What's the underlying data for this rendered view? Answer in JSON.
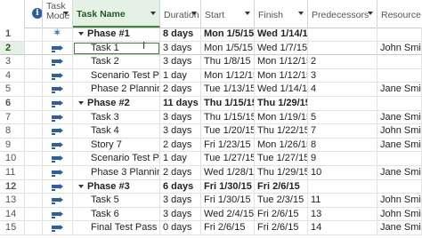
{
  "columns": {
    "mode": "Task Mode",
    "name": "Task Name",
    "duration": "Duration",
    "start": "Start",
    "finish": "Finish",
    "predecessors": "Predecessors",
    "resource": "Resource Na"
  },
  "info_glyph": "i",
  "cursor_glyph": "I",
  "rows": [
    {
      "num": "1",
      "mode": "manual-pin",
      "name": "Phase #1",
      "duration": "8 days",
      "start": "Mon 1/5/15",
      "finish": "Wed 1/14/15",
      "pred": "",
      "res": "",
      "summary": true
    },
    {
      "num": "2",
      "mode": "auto",
      "name": "Task 1",
      "duration": "3 days",
      "start": "Mon 1/5/15",
      "finish": "Wed 1/7/15",
      "pred": "",
      "res": "John Smith",
      "summary": false
    },
    {
      "num": "3",
      "mode": "auto",
      "name": "Task 2",
      "duration": "3 days",
      "start": "Thu 1/8/15",
      "finish": "Mon 1/12/15",
      "pred": "2",
      "res": "",
      "summary": false
    },
    {
      "num": "4",
      "mode": "auto",
      "name": "Scenario Test Pass",
      "duration": "1 day",
      "start": "Mon 1/12/15",
      "finish": "Mon 1/12/15",
      "pred": "3",
      "res": "",
      "summary": false
    },
    {
      "num": "5",
      "mode": "auto",
      "name": "Phase 2 Planning",
      "duration": "2 days",
      "start": "Tue 1/13/15",
      "finish": "Wed 1/14/15",
      "pred": "4",
      "res": "Jane Smith",
      "summary": false
    },
    {
      "num": "6",
      "mode": "auto",
      "name": "Phase #2",
      "duration": "11 days",
      "start": "Thu 1/15/15",
      "finish": "Thu 1/29/15",
      "pred": "",
      "res": "",
      "summary": true
    },
    {
      "num": "7",
      "mode": "auto",
      "name": "Task 3",
      "duration": "3 days",
      "start": "Thu 1/15/15",
      "finish": "Mon 1/19/15",
      "pred": "5",
      "res": "Jane Smith",
      "summary": false
    },
    {
      "num": "8",
      "mode": "auto",
      "name": "Task 4",
      "duration": "3 days",
      "start": "Tue 1/20/15",
      "finish": "Thu 1/22/15",
      "pred": "7",
      "res": "John Smith",
      "summary": false
    },
    {
      "num": "9",
      "mode": "auto",
      "name": "Story 7",
      "duration": "2 days",
      "start": "Fri 1/23/15",
      "finish": "Mon 1/26/15",
      "pred": "8",
      "res": "Jane Smith",
      "summary": false
    },
    {
      "num": "10",
      "mode": "auto",
      "name": "Scenario Test Pass",
      "duration": "1 day",
      "start": "Tue 1/27/15",
      "finish": "Tue 1/27/15",
      "pred": "9",
      "res": "",
      "summary": false
    },
    {
      "num": "11",
      "mode": "auto",
      "name": "Phase  3 Planning",
      "duration": "2 days",
      "start": "Wed 1/28/15",
      "finish": "Thu 1/29/15",
      "pred": "10",
      "res": "Jane Smith",
      "summary": false
    },
    {
      "num": "12",
      "mode": "auto",
      "name": "Phase #3",
      "duration": "6 days",
      "start": "Fri 1/30/15",
      "finish": "Fri 2/6/15",
      "pred": "",
      "res": "",
      "summary": true
    },
    {
      "num": "13",
      "mode": "auto",
      "name": "Task 5",
      "duration": "3 days",
      "start": "Fri 1/30/15",
      "finish": "Tue 2/3/15",
      "pred": "11",
      "res": "John Smith",
      "summary": false
    },
    {
      "num": "14",
      "mode": "auto",
      "name": "Task 6",
      "duration": "3 days",
      "start": "Wed 2/4/15",
      "finish": "Fri 2/6/15",
      "pred": "13",
      "res": "John Smith",
      "summary": false
    },
    {
      "num": "15",
      "mode": "auto",
      "name": "Final Test Pass",
      "duration": "0 days",
      "start": "Fri 2/6/15",
      "finish": "Fri 2/6/15",
      "pred": "14",
      "res": "Jane Smith",
      "summary": false
    }
  ],
  "selected_row": "2"
}
